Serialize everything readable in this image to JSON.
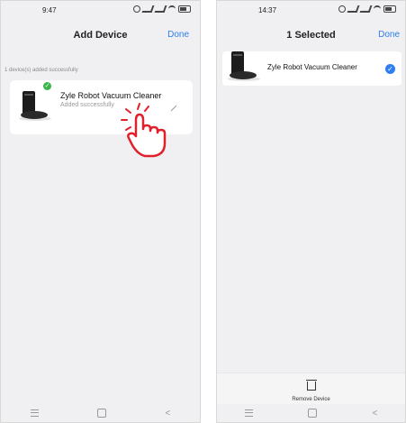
{
  "left": {
    "status_time": "9:47",
    "title": "Add Device",
    "done_label": "Done",
    "notice": "1 device(s) added successfully",
    "device": {
      "name": "Zyle Robot Vacuum Cleaner",
      "status": "Added successfully"
    }
  },
  "right": {
    "status_time": "14:37",
    "title": "1 Selected",
    "done_label": "Done",
    "device": {
      "name": "Zyle Robot Vacuum Cleaner"
    },
    "remove_label": "Remove Device"
  },
  "colors": {
    "accent": "#2d7ef0",
    "success": "#3bb54a",
    "tap_hint": "#e0202a"
  },
  "icons": [
    "checkmark-icon",
    "pencil-icon",
    "tap-hand-icon",
    "trash-icon",
    "wifi-icon",
    "battery-icon"
  ]
}
